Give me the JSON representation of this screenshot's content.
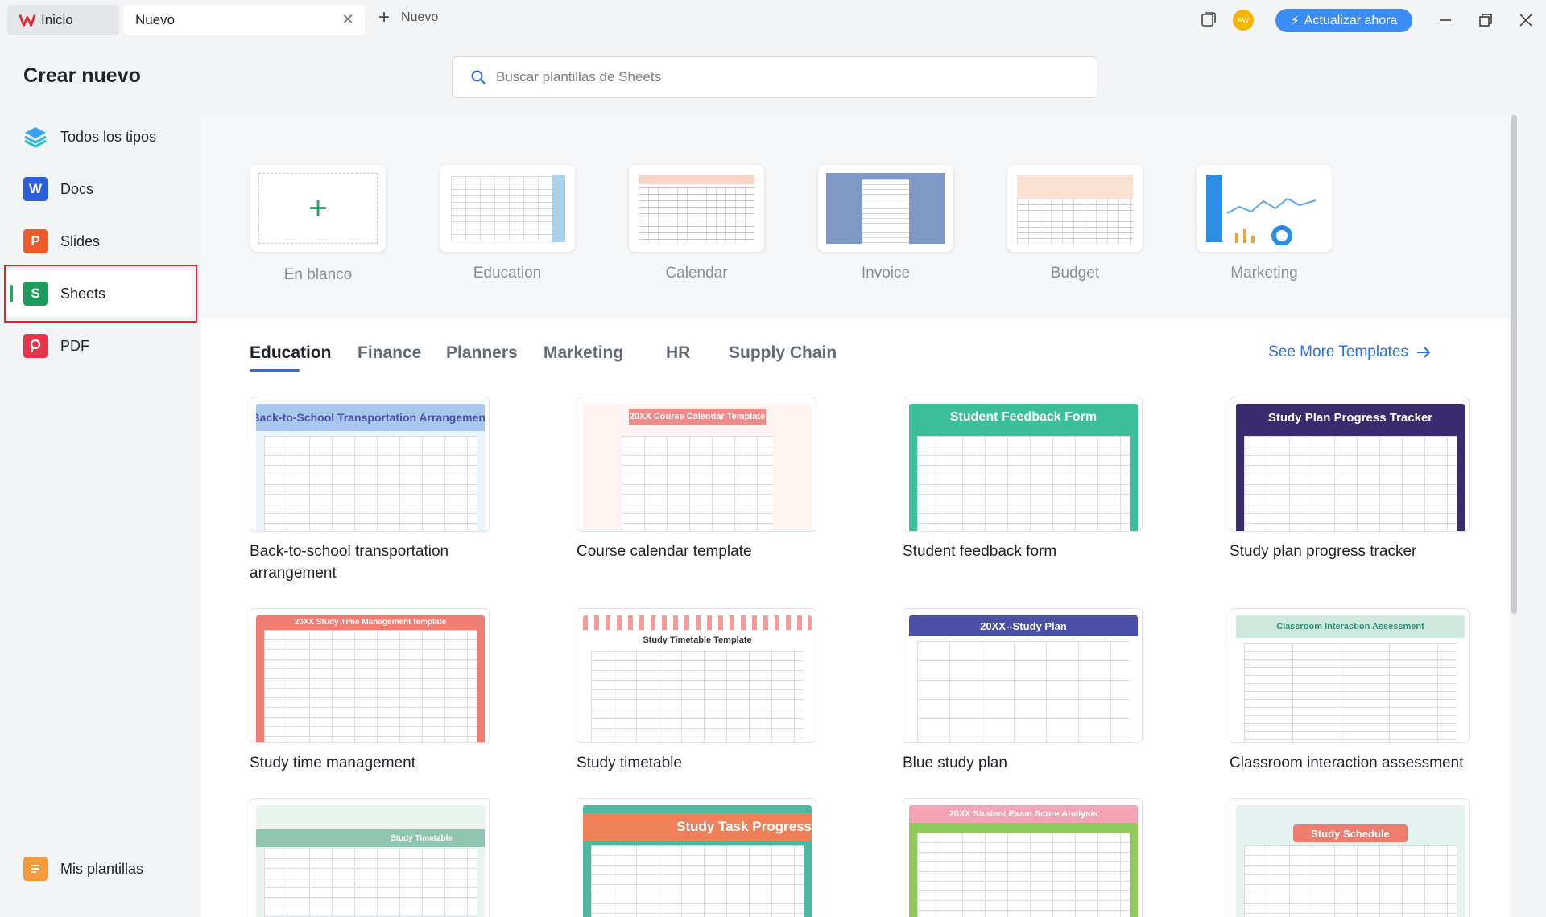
{
  "titlebar": {
    "tabs": [
      {
        "label": "Inicio"
      },
      {
        "label": "Nuevo"
      }
    ],
    "new_tab_label": "Nuevo",
    "avatar_initials": "AW",
    "upgrade_label": "Actualizar ahora"
  },
  "sidebar": {
    "title": "Crear nuevo",
    "items": [
      {
        "label": "Todos los tipos",
        "icon": "layers-icon"
      },
      {
        "label": "Docs",
        "icon": "docs-icon",
        "letter": "W",
        "color": "#2b5fd9"
      },
      {
        "label": "Slides",
        "icon": "slides-icon",
        "letter": "P",
        "color": "#f05a28"
      },
      {
        "label": "Sheets",
        "icon": "sheets-icon",
        "letter": "S",
        "color": "#1a9d5c"
      },
      {
        "label": "PDF",
        "icon": "pdf-icon",
        "letter": "P",
        "color": "#e8344a"
      }
    ],
    "bottom_item": {
      "label": "Mis plantillas",
      "icon": "templates-icon"
    }
  },
  "search": {
    "placeholder": "Buscar plantillas de Sheets"
  },
  "quick_start": [
    {
      "label": "En blanco"
    },
    {
      "label": "Education"
    },
    {
      "label": "Calendar"
    },
    {
      "label": "Invoice"
    },
    {
      "label": "Budget"
    },
    {
      "label": "Marketing"
    }
  ],
  "categories": {
    "tabs": [
      "Education",
      "Finance",
      "Planners",
      "Marketing",
      "HR",
      "Supply Chain"
    ],
    "active": "Education",
    "see_more_label": "See More Templates"
  },
  "templates": [
    {
      "name": "Back-to-school transportation arrangement",
      "thumb_title": "Back-to-School Transportation Arrangement",
      "color": "#a9c8ef"
    },
    {
      "name": "Course calendar template",
      "thumb_title": "20XX Course Calendar Template",
      "color": "#f18a8a"
    },
    {
      "name": "Student feedback form",
      "thumb_title": "Student Feedback Form",
      "color": "#3dbf9b"
    },
    {
      "name": "Study plan progress tracker",
      "thumb_title": "Study Plan Progress Tracker",
      "color": "#3a2a6e"
    },
    {
      "name": "Study time management",
      "thumb_title": "20XX Study Time Management template",
      "color": "#f07d72"
    },
    {
      "name": "Study timetable",
      "thumb_title": "Study Timetable Template",
      "color": "#f39b9b"
    },
    {
      "name": "Blue study plan",
      "thumb_title": "20XX--Study Plan",
      "color": "#4a4fa8"
    },
    {
      "name": "Classroom interaction assessment",
      "thumb_title": "Classroom Interaction Assessment",
      "color": "#cfe9df"
    },
    {
      "name": "",
      "thumb_title": "Study Timetable",
      "color": "#8fc6b1"
    },
    {
      "name": "",
      "thumb_title": "Study Task Progress",
      "color": "#ef8058"
    },
    {
      "name": "",
      "thumb_title": "20XX Student Exam Score Analysis",
      "color": "#f3a3b4"
    },
    {
      "name": "",
      "thumb_title": "Study Schedule",
      "color": "#ee7d6e"
    }
  ]
}
